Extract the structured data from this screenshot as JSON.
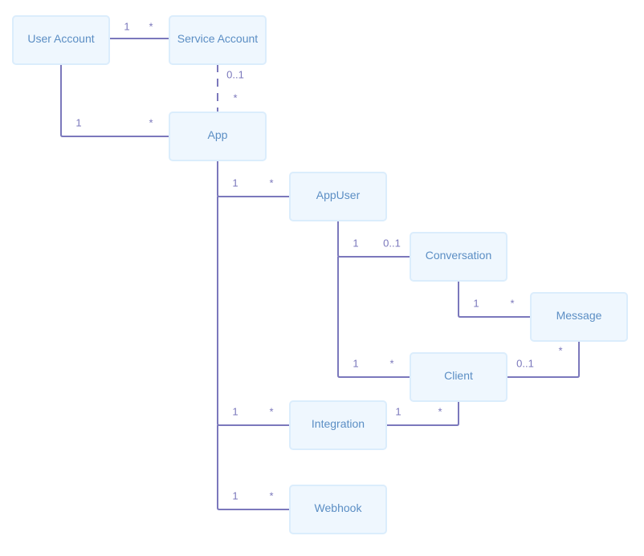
{
  "diagram": {
    "type": "entity-relationship",
    "colors": {
      "node_fill": "#eff7fe",
      "node_border": "#dbedfc",
      "node_text": "#5b8ec4",
      "edge": "#7b78bc",
      "multiplicity_text": "#7b78bc"
    },
    "nodes": [
      {
        "id": "user-account",
        "label": "User Account"
      },
      {
        "id": "service-account",
        "label": "Service Account"
      },
      {
        "id": "app",
        "label": "App"
      },
      {
        "id": "appuser",
        "label": "AppUser"
      },
      {
        "id": "conversation",
        "label": "Conversation"
      },
      {
        "id": "message",
        "label": "Message"
      },
      {
        "id": "client",
        "label": "Client"
      },
      {
        "id": "integration",
        "label": "Integration"
      },
      {
        "id": "webhook",
        "label": "Webhook"
      }
    ],
    "edges": [
      {
        "from": "user-account",
        "to": "service-account",
        "from_mult": "1",
        "to_mult": "*",
        "style": "solid"
      },
      {
        "from": "service-account",
        "to": "app",
        "from_mult": "0..1",
        "to_mult": "*",
        "style": "dashed"
      },
      {
        "from": "user-account",
        "to": "app",
        "from_mult": "1",
        "to_mult": "*",
        "style": "solid"
      },
      {
        "from": "app",
        "to": "appuser",
        "from_mult": "1",
        "to_mult": "*",
        "style": "solid"
      },
      {
        "from": "appuser",
        "to": "conversation",
        "from_mult": "1",
        "to_mult": "0..1",
        "style": "solid"
      },
      {
        "from": "conversation",
        "to": "message",
        "from_mult": "1",
        "to_mult": "*",
        "style": "solid"
      },
      {
        "from": "appuser",
        "to": "client",
        "from_mult": "1",
        "to_mult": "*",
        "style": "solid"
      },
      {
        "from": "client",
        "to": "message",
        "from_mult": "0..1",
        "to_mult": "*",
        "style": "solid"
      },
      {
        "from": "app",
        "to": "integration",
        "from_mult": "1",
        "to_mult": "*",
        "style": "solid"
      },
      {
        "from": "integration",
        "to": "client",
        "from_mult": "1",
        "to_mult": "*",
        "style": "solid"
      },
      {
        "from": "app",
        "to": "webhook",
        "from_mult": "1",
        "to_mult": "*",
        "style": "solid"
      }
    ]
  }
}
